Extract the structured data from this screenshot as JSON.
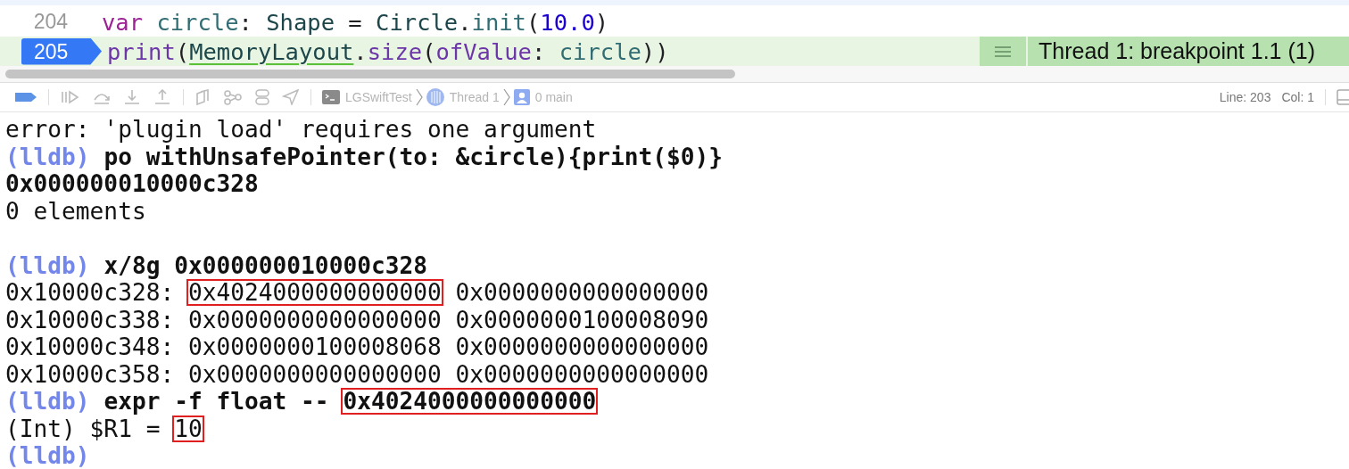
{
  "editor": {
    "lines": [
      {
        "number": "204",
        "current": false,
        "tokens": [
          {
            "kind": "keyword",
            "text": "var"
          },
          {
            "kind": "variable",
            "text": " circle"
          },
          {
            "kind": "plain",
            "text": ": "
          },
          {
            "kind": "type",
            "text": "Shape"
          },
          {
            "kind": "plain",
            "text": " = "
          },
          {
            "kind": "type",
            "text": "Circle"
          },
          {
            "kind": "plain",
            "text": "."
          },
          {
            "kind": "method",
            "text": "init"
          },
          {
            "kind": "plain",
            "text": "("
          },
          {
            "kind": "number",
            "text": "10.0"
          },
          {
            "kind": "plain",
            "text": ")"
          }
        ]
      },
      {
        "number": "205",
        "current": true,
        "tokens": [
          {
            "kind": "function",
            "text": "print"
          },
          {
            "kind": "plain",
            "text": "("
          },
          {
            "kind": "warning",
            "text": "MemoryLayout"
          },
          {
            "kind": "plain",
            "text": "."
          },
          {
            "kind": "function",
            "text": "size"
          },
          {
            "kind": "plain",
            "text": "("
          },
          {
            "kind": "function",
            "text": "ofValue"
          },
          {
            "kind": "plain",
            "text": ": "
          },
          {
            "kind": "variable",
            "text": "circle"
          },
          {
            "kind": "plain",
            "text": "))"
          }
        ]
      }
    ],
    "annotation": "Thread 1: breakpoint 1.1 (1)"
  },
  "debug_bar": {
    "breadcrumbs": [
      {
        "kind": "target",
        "label": "LGSwiftTest"
      },
      {
        "kind": "thread",
        "label": "Thread 1"
      },
      {
        "kind": "frame",
        "label": "0 main"
      }
    ],
    "line": "Line: 203",
    "col": "Col: 1"
  },
  "console": {
    "blocks": [
      {
        "lines": [
          [
            {
              "kind": "plain",
              "text": "error: 'plugin load' requires one argument",
              "highlighted": false
            }
          ],
          [
            {
              "kind": "prompt",
              "text": "(lldb)",
              "highlighted": false
            },
            {
              "kind": "command",
              "text": " po withUnsafePointer(to: &circle){print($0)}",
              "highlighted": false
            }
          ],
          [
            {
              "kind": "command",
              "text": "0x000000010000c328",
              "highlighted": false
            }
          ],
          [
            {
              "kind": "plain",
              "text": "0 elements",
              "highlighted": false
            }
          ]
        ]
      },
      {
        "lines": [
          [
            {
              "kind": "prompt",
              "text": "(lldb)",
              "highlighted": false
            },
            {
              "kind": "command",
              "text": " x/8g 0x000000010000c328",
              "highlighted": false
            }
          ],
          [
            {
              "kind": "plain",
              "text": "0x10000c328: ",
              "highlighted": false
            },
            {
              "kind": "plain",
              "text": "0x4024000000000000",
              "highlighted": true
            },
            {
              "kind": "plain",
              "text": " 0x0000000000000000",
              "highlighted": false
            }
          ],
          [
            {
              "kind": "plain",
              "text": "0x10000c338: 0x0000000000000000 0x0000000100008090",
              "highlighted": false
            }
          ],
          [
            {
              "kind": "plain",
              "text": "0x10000c348: 0x0000000100008068 0x0000000000000000",
              "highlighted": false
            }
          ],
          [
            {
              "kind": "plain",
              "text": "0x10000c358: 0x0000000000000000 0x0000000000000000",
              "highlighted": false
            }
          ],
          [
            {
              "kind": "prompt",
              "text": "(lldb)",
              "highlighted": false
            },
            {
              "kind": "command",
              "text": " expr -f float -- ",
              "highlighted": false
            },
            {
              "kind": "command",
              "text": "0x4024000000000000",
              "highlighted": true
            }
          ],
          [
            {
              "kind": "plain",
              "text": "(Int) $R1 = ",
              "highlighted": false
            },
            {
              "kind": "plain",
              "text": "10",
              "highlighted": true
            }
          ],
          [
            {
              "kind": "prompt",
              "text": "(lldb)",
              "highlighted": false
            }
          ]
        ]
      }
    ]
  }
}
